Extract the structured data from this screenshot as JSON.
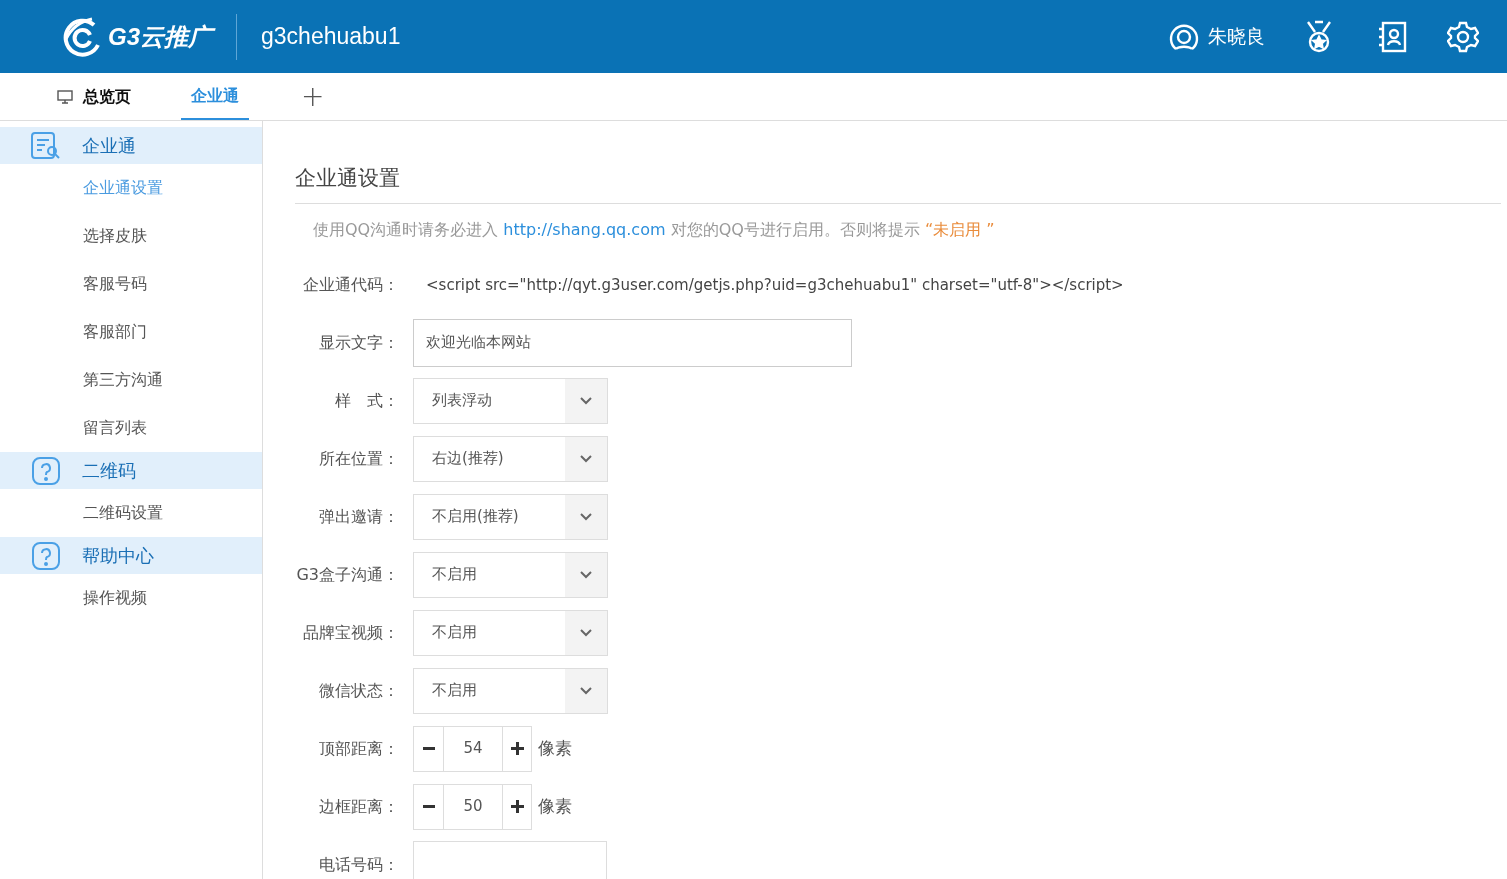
{
  "header": {
    "logo_text": "G3云推广",
    "account": "g3chehuabu1",
    "user": "朱晓良"
  },
  "tabs": [
    {
      "label": "总览页",
      "selected": false,
      "kind": "home"
    },
    {
      "label": "企业通",
      "selected": true,
      "kind": "plain"
    },
    {
      "label": "+",
      "selected": false,
      "kind": "add"
    }
  ],
  "sidebar": [
    {
      "label": "企业通",
      "kind": "doc",
      "children": [
        {
          "label": "企业通设置",
          "selected": true
        },
        {
          "label": "选择皮肤",
          "selected": false
        },
        {
          "label": "客服号码",
          "selected": false
        },
        {
          "label": "客服部门",
          "selected": false
        },
        {
          "label": "第三方沟通",
          "selected": false
        },
        {
          "label": "留言列表",
          "selected": false
        }
      ]
    },
    {
      "label": "二维码",
      "kind": "question",
      "children": [
        {
          "label": "二维码设置",
          "selected": false
        }
      ]
    },
    {
      "label": "帮助中心",
      "kind": "question",
      "children": [
        {
          "label": "操作视频",
          "selected": false
        }
      ]
    }
  ],
  "page_title": "企业通设置",
  "hint": {
    "before": "使用QQ沟通时请务必进入",
    "link": "http://shang.qq.com",
    "after": "对您的QQ号进行启用。否则将提示",
    "status": "“未启用 ”"
  },
  "form": [
    {
      "label": "企业通代码：",
      "kind": "code",
      "value": "<script src=\"http://qyt.g3user.com/getjs.php?uid=g3chehuabu1\" charset=\"utf-8\"></script>"
    },
    {
      "label": "显示文字：",
      "kind": "text",
      "value": "欢迎光临本网站"
    },
    {
      "label": "样　式：",
      "kind": "select",
      "value": "列表浮动"
    },
    {
      "label": "所在位置：",
      "kind": "select",
      "value": "右边(推荐)"
    },
    {
      "label": "弹出邀请：",
      "kind": "select",
      "value": "不启用(推荐)"
    },
    {
      "label": "G3盒子沟通：",
      "kind": "select",
      "value": "不启用"
    },
    {
      "label": "品牌宝视频：",
      "kind": "select",
      "value": "不启用"
    },
    {
      "label": "微信状态：",
      "kind": "select",
      "value": "不启用"
    },
    {
      "label": "顶部距离：",
      "kind": "stepper",
      "value": "54",
      "unit": "像素"
    },
    {
      "label": "边框距离：",
      "kind": "stepper",
      "value": "50",
      "unit": "像素"
    },
    {
      "label": "电话号码：",
      "kind": "phone"
    }
  ]
}
